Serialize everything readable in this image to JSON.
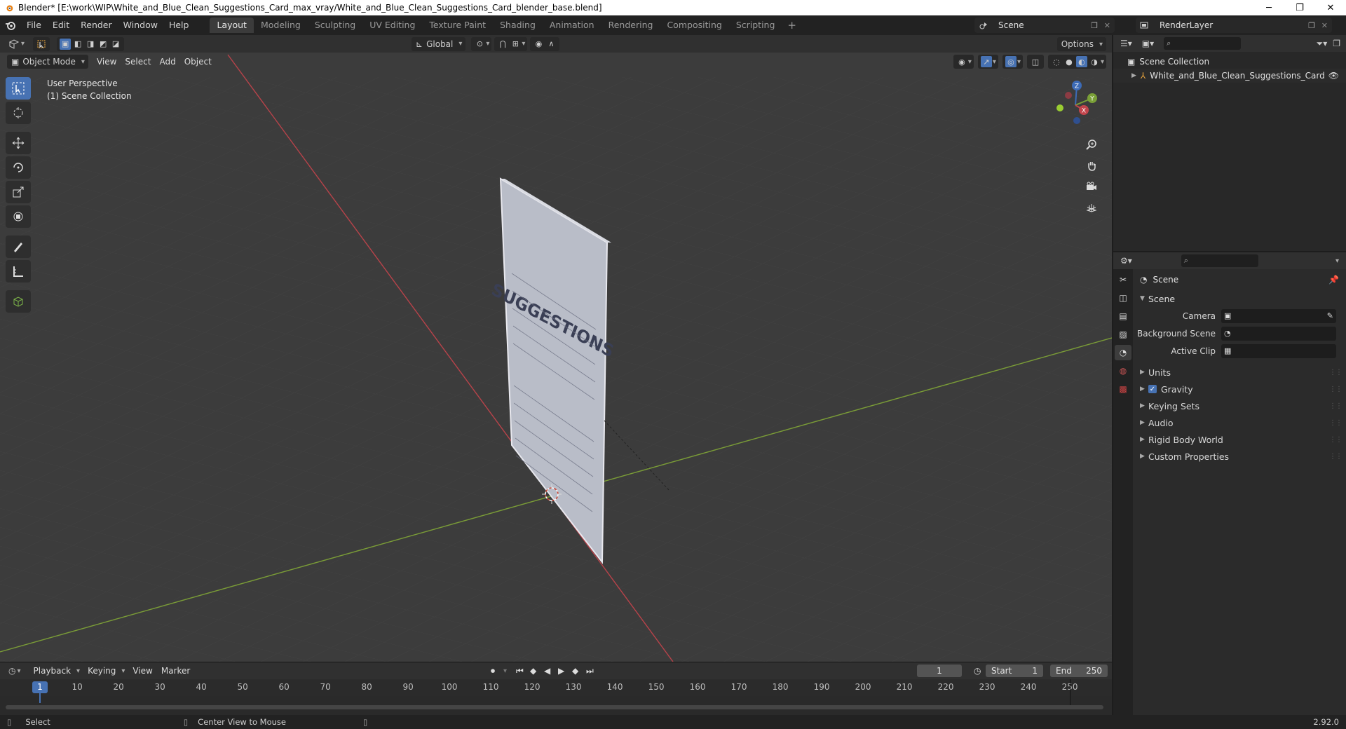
{
  "window": {
    "title": "Blender* [E:\\work\\WIP\\White_and_Blue_Clean_Suggestions_Card_max_vray/White_and_Blue_Clean_Suggestions_Card_blender_base.blend]"
  },
  "menu": [
    "File",
    "Edit",
    "Render",
    "Window",
    "Help"
  ],
  "workspaces": [
    "Layout",
    "Modeling",
    "Sculpting",
    "UV Editing",
    "Texture Paint",
    "Shading",
    "Animation",
    "Rendering",
    "Compositing",
    "Scripting"
  ],
  "active_workspace": "Layout",
  "scene_selector": "Scene",
  "renderlayer_selector": "RenderLayer",
  "viewport": {
    "mode": "Object Mode",
    "menus": [
      "View",
      "Select",
      "Add",
      "Object"
    ],
    "transform_orientation": "Global",
    "options_label": "Options",
    "info_line1": "User Perspective",
    "info_line2": "(1) Scene Collection",
    "card_title": "SUGGESTIONS",
    "gizmo_axes": {
      "x": "X",
      "y": "Y",
      "z": "Z"
    }
  },
  "timeline": {
    "menus": [
      "Playback",
      "Keying",
      "View",
      "Marker"
    ],
    "current_frame": "1",
    "start_label": "Start",
    "start_value": "1",
    "end_label": "End",
    "end_value": "250",
    "ticks": [
      "1",
      "10",
      "20",
      "30",
      "40",
      "50",
      "60",
      "70",
      "80",
      "90",
      "100",
      "110",
      "120",
      "130",
      "140",
      "150",
      "160",
      "170",
      "180",
      "190",
      "200",
      "210",
      "220",
      "230",
      "240",
      "250"
    ]
  },
  "statusbar": {
    "left": "Select",
    "middle": "Center View to Mouse",
    "version": "2.92.0"
  },
  "outliner": {
    "root": "Scene Collection",
    "item": "White_and_Blue_Clean_Suggestions_Card"
  },
  "properties": {
    "context_title": "Scene",
    "section": "Scene",
    "fields": [
      {
        "label": "Camera"
      },
      {
        "label": "Background Scene"
      },
      {
        "label": "Active Clip"
      }
    ],
    "subpanels": [
      "Units",
      "Gravity",
      "Keying Sets",
      "Audio",
      "Rigid Body World",
      "Custom Properties"
    ]
  },
  "colors": {
    "accent": "#4772b3",
    "viewport_bg": "#3c3c3c",
    "x_axis": "#c2454c",
    "y_axis": "#7ea23a"
  }
}
